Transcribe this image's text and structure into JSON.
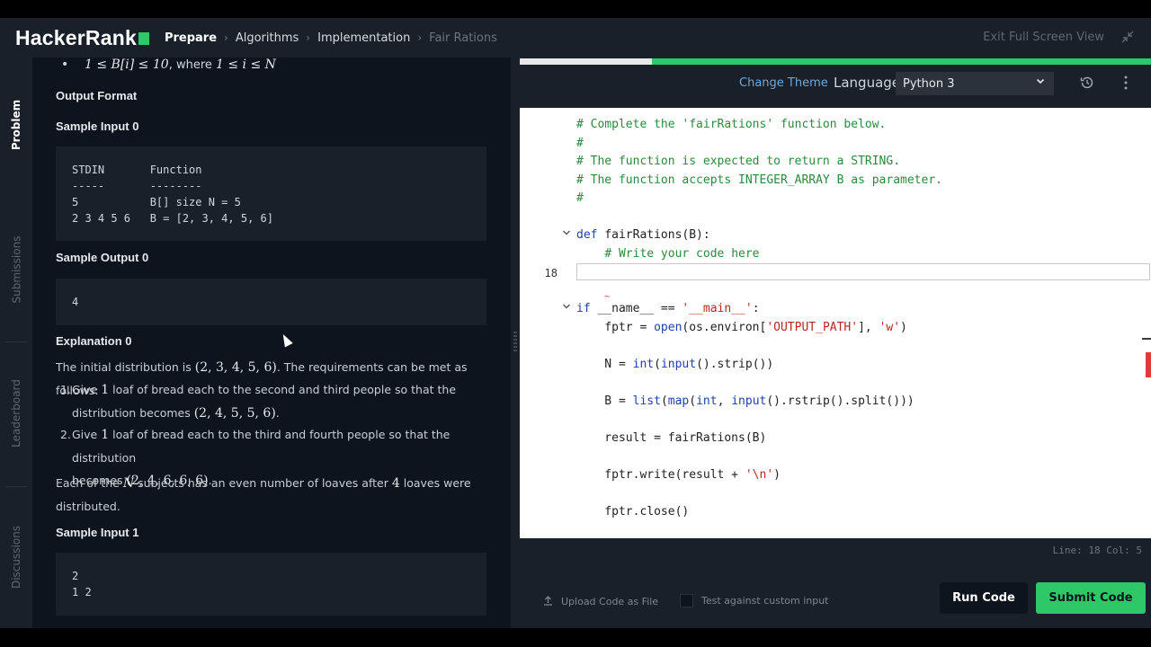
{
  "header": {
    "logo": "HackerRank",
    "breadcrumbs": [
      "Prepare",
      "Algorithms",
      "Implementation",
      "Fair Rations"
    ],
    "exit_fullscreen": "Exit Full Screen View",
    "icons": {
      "breadcrumb_sep": "chevron-right-icon",
      "exit": "compress-icon"
    }
  },
  "colors": {
    "brand": "#2ec866",
    "bg": "#0e141e",
    "panel": "#1a2029",
    "link": "#6ea8d8"
  },
  "left_tabs": [
    "Problem",
    "Submissions",
    "Leaderboard",
    "Discussions"
  ],
  "problem": {
    "constraint": {
      "math": "1 ≤ B[i] ≤ 10",
      "mid": ", where ",
      "math2": "1 ≤ i ≤ N"
    },
    "output_format_title": "Output Format",
    "sample_input_0_title": "Sample Input 0",
    "sample_input_0_lines": [
      "STDIN       Function",
      "-----       --------",
      "5           B[] size N = 5",
      "2 3 4 5 6   B = [2, 3, 4, 5, 6]"
    ],
    "sample_output_0_title": "Sample Output 0",
    "sample_output_0_lines": [
      "4"
    ],
    "explanation_0_title": "Explanation 0",
    "explanation_intro": {
      "pre": "The initial distribution is ",
      "m": "(2, 3, 4, 5, 6)",
      "post": ". The requirements can be met as follows:"
    },
    "steps": [
      {
        "num": "1.",
        "pre": "Give ",
        "m": "1",
        "post": " loaf of bread each to the second and third people so that the",
        "line2_pre": "distribution becomes ",
        "line2_m": "(2, 4, 5, 5, 6)",
        "line2_post": "."
      },
      {
        "num": "2.",
        "pre": "Give ",
        "m": "1",
        "post": " loaf of bread each to the third and fourth people so that the distribution",
        "line2_pre": "becomes ",
        "line2_m": "(2, 4, 6, 6, 6)",
        "line2_post": "."
      }
    ],
    "summary": {
      "pre": "Each of the ",
      "m": "N",
      "mid": " subjects has an even number of loaves after ",
      "m2": "4",
      "post": " loaves were",
      "line2": "distributed."
    },
    "sample_input_1_title": "Sample Input 1",
    "sample_input_1_lines": [
      "2",
      "1 2"
    ]
  },
  "toolbar": {
    "progress_fraction": 0.79,
    "change_theme": "Change Theme",
    "language_label": "Language",
    "language_value": "Python 3",
    "icons": {
      "history": "history-icon",
      "menu": "more-vertical-icon",
      "dropdown": "chevron-down-icon"
    }
  },
  "editor": {
    "current_line_number": "18",
    "lines": [
      {
        "fold": "",
        "html": "<span class=\"c-com\"># Complete the 'fairRations' function below.</span>"
      },
      {
        "fold": "",
        "html": "<span class=\"c-com\">#</span>"
      },
      {
        "fold": "",
        "html": "<span class=\"c-com\"># The function is expected to return a STRING.</span>"
      },
      {
        "fold": "",
        "html": "<span class=\"c-com\"># The function accepts INTEGER_ARRAY B as parameter.</span>"
      },
      {
        "fold": "",
        "html": "<span class=\"c-com\">#</span>"
      },
      {
        "fold": "",
        "html": ""
      },
      {
        "fold": "v",
        "html": "<span class=\"c-kw\">def</span> fairRations(B):"
      },
      {
        "fold": "",
        "html": "    <span class=\"c-com\"># Write your code here</span>"
      },
      {
        "fold": "",
        "html": "",
        "current": true
      },
      {
        "fold": "",
        "html": ""
      },
      {
        "fold": "v",
        "html": "<span class=\"c-kw\">if</span> __name__ == <span class=\"c-str\">'__main__'</span>:"
      },
      {
        "fold": "",
        "html": "    fptr = <span class=\"c-fn\">open</span>(os.environ[<span class=\"c-str\">'OUTPUT_PATH'</span>], <span class=\"c-str\">'w'</span>)"
      },
      {
        "fold": "",
        "html": ""
      },
      {
        "fold": "",
        "html": "    N = <span class=\"c-fn\">int</span>(<span class=\"c-fn\">input</span>().strip())"
      },
      {
        "fold": "",
        "html": ""
      },
      {
        "fold": "",
        "html": "    B = <span class=\"c-fn\">list</span>(<span class=\"c-fn\">map</span>(<span class=\"c-fn\">int</span>, <span class=\"c-fn\">input</span>().rstrip().split()))"
      },
      {
        "fold": "",
        "html": ""
      },
      {
        "fold": "",
        "html": "    result = fairRations(B)"
      },
      {
        "fold": "",
        "html": ""
      },
      {
        "fold": "",
        "html": "    fptr.write(result + <span class=\"c-str\">'\\n'</span>)"
      },
      {
        "fold": "",
        "html": ""
      },
      {
        "fold": "",
        "html": "    fptr.close()"
      }
    ],
    "status": "Line: 18 Col: 5"
  },
  "footer": {
    "upload": "Upload Code as File",
    "custom_input": "Test against custom input",
    "run": "Run Code",
    "submit": "Submit Code",
    "icons": {
      "upload": "upload-icon"
    }
  }
}
